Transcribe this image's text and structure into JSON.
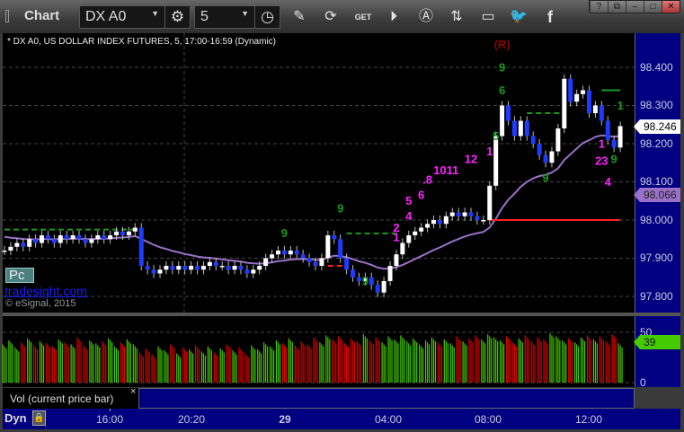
{
  "window": {
    "title": "Chart",
    "symbol": "DX A0",
    "interval": "5",
    "buttons": [
      "?",
      "restore",
      "minimize",
      "maximize",
      "close"
    ]
  },
  "toolbar": {
    "icons": [
      "settings-gear-icon",
      "clock-icon",
      "pencil-icon",
      "refresh-icon",
      "get-icon",
      "play-icon",
      "a-icon",
      "link-icon",
      "comment-icon",
      "twitter-icon",
      "facebook-icon"
    ],
    "get_label": "GET"
  },
  "chart_info": "* DX A0, US DOLLAR INDEX FUTURES, 5, 17:00-16:59 (Dynamic)",
  "badges": {
    "pc": "Pc",
    "brand": "tradesight.com",
    "copyright": "© eSignal, 2015"
  },
  "colors": {
    "up": "#ffffff",
    "down": "#1e3cff",
    "ma": "#9a70c8",
    "vol_up": "#44cc00",
    "vol_down": "#e00000",
    "axis_bg": "#000080"
  },
  "chart_data": {
    "type": "candlestick",
    "ylim": [
      97.78,
      98.47
    ],
    "y_ticks": [
      "98.400",
      "98.300",
      "98.200",
      "98.100",
      "98.000",
      "97.900",
      "97.800"
    ],
    "x_ticks": [
      "16:00",
      "20:20",
      "29",
      "04:00",
      "08:00",
      "12:00"
    ],
    "last_price": "98.246",
    "ma_value": "98.066",
    "closes": [
      97.92,
      97.93,
      97.94,
      97.93,
      97.95,
      97.94,
      97.96,
      97.95,
      97.94,
      97.96,
      97.95,
      97.96,
      97.95,
      97.94,
      97.95,
      97.96,
      97.95,
      97.96,
      97.97,
      97.96,
      97.97,
      97.98,
      97.88,
      97.87,
      97.86,
      97.87,
      97.88,
      97.87,
      97.88,
      97.87,
      97.88,
      97.87,
      97.88,
      97.89,
      97.88,
      97.88,
      97.87,
      97.88,
      97.87,
      97.86,
      97.87,
      97.88,
      97.9,
      97.91,
      97.92,
      97.91,
      97.92,
      97.91,
      97.9,
      97.89,
      97.88,
      97.9,
      97.96,
      97.95,
      97.9,
      97.87,
      97.85,
      97.84,
      97.85,
      97.83,
      97.81,
      97.84,
      97.88,
      97.91,
      97.94,
      97.96,
      97.97,
      97.98,
      97.99,
      98.0,
      97.99,
      98.01,
      98.02,
      98.01,
      98.02,
      98.01,
      98.0,
      98.0,
      98.09,
      98.22,
      98.3,
      98.26,
      98.22,
      98.26,
      98.22,
      98.2,
      98.17,
      98.15,
      98.18,
      98.24,
      98.37,
      98.31,
      98.33,
      98.34,
      98.28,
      98.3,
      98.26,
      98.21,
      98.19,
      98.246
    ],
    "levels": [
      {
        "price": 97.975,
        "from": 0,
        "to": 22,
        "color": "#1a9a1a",
        "style": "dashed"
      },
      {
        "price": 97.965,
        "from": 55,
        "to": 63,
        "color": "#1a9a1a",
        "style": "dashed"
      },
      {
        "price": 98.28,
        "from": 84,
        "to": 90,
        "color": "#1a9a1a",
        "style": "dashed"
      },
      {
        "price": 98.34,
        "from": 96,
        "to": 99,
        "color": "#1a9a1a",
        "style": "solid"
      },
      {
        "price": 98.0,
        "from": 78,
        "to": 99,
        "color": "#ff2020",
        "style": "solid"
      },
      {
        "price": 97.88,
        "from": 52,
        "to": 55,
        "color": "#ff2020",
        "style": "dashed"
      }
    ],
    "annotations": [
      {
        "text": "(R)",
        "bar": 80,
        "price": 98.45,
        "color": "#8b0000"
      },
      {
        "text": "9",
        "bar": 80,
        "price": 98.39,
        "color": "#1a9a1a"
      },
      {
        "text": "6",
        "bar": 80,
        "price": 98.33,
        "color": "#1a9a1a"
      },
      {
        "text": "5",
        "bar": 79,
        "price": 98.21,
        "color": "#1a9a1a"
      },
      {
        "text": "9",
        "bar": 45,
        "price": 97.955,
        "color": "#1a9a1a"
      },
      {
        "text": "9",
        "bar": 54,
        "price": 98.02,
        "color": "#1a9a1a"
      },
      {
        "text": "9",
        "bar": 58,
        "price": 97.83,
        "color": "#1a9a1a"
      },
      {
        "text": "9",
        "bar": 87,
        "price": 98.1,
        "color": "#1a9a1a"
      },
      {
        "text": "1",
        "bar": 99,
        "price": 98.29,
        "color": "#1a9a1a"
      },
      {
        "text": "9",
        "bar": 98,
        "price": 98.15,
        "color": "#1a9a1a"
      },
      {
        "text": "1",
        "bar": 63,
        "price": 97.945,
        "color": "#ff22ff"
      },
      {
        "text": "2",
        "bar": 63,
        "price": 97.97,
        "color": "#ff22ff"
      },
      {
        "text": "4",
        "bar": 65,
        "price": 98.0,
        "color": "#ff22ff"
      },
      {
        "text": "5",
        "bar": 65,
        "price": 98.04,
        "color": "#ff22ff"
      },
      {
        "text": "6",
        "bar": 67,
        "price": 98.055,
        "color": "#ff22ff"
      },
      {
        "text": ".8",
        "bar": 68,
        "price": 98.095,
        "color": "#ff22ff"
      },
      {
        "text": "1011",
        "bar": 71,
        "price": 98.12,
        "color": "#ff22ff"
      },
      {
        "text": "12",
        "bar": 75,
        "price": 98.15,
        "color": "#ff22ff"
      },
      {
        "text": "1",
        "bar": 78,
        "price": 98.17,
        "color": "#ff22ff"
      },
      {
        "text": "1",
        "bar": 96,
        "price": 98.19,
        "color": "#ff22ff"
      },
      {
        "text": "23",
        "bar": 96,
        "price": 98.145,
        "color": "#ff22ff"
      },
      {
        "text": "4",
        "bar": 97,
        "price": 98.09,
        "color": "#ff22ff"
      }
    ],
    "volume": {
      "y_ticks": [
        "50",
        "0"
      ],
      "last": "39",
      "values": [
        38,
        42,
        35,
        40,
        44,
        37,
        41,
        39,
        36,
        43,
        40,
        38,
        45,
        37,
        42,
        39,
        41,
        44,
        36,
        40,
        43,
        38,
        30,
        34,
        28,
        36,
        32,
        38,
        29,
        35,
        33,
        37,
        31,
        36,
        30,
        34,
        38,
        32,
        35,
        29,
        37,
        33,
        40,
        36,
        42,
        39,
        44,
        37,
        41,
        38,
        45,
        40,
        47,
        43,
        46,
        39,
        44,
        41,
        48,
        42,
        45,
        40,
        46,
        43,
        47,
        41,
        44,
        38,
        42,
        45,
        40,
        43,
        39,
        46,
        41,
        44,
        47,
        43,
        48,
        45,
        42,
        46,
        40,
        44,
        47,
        41,
        45,
        43,
        49,
        46,
        42,
        44,
        40,
        45,
        47,
        43,
        46,
        41,
        48,
        39
      ]
    },
    "vol_label": "Vol (current price bar)",
    "dyn_label": "Dyn"
  }
}
